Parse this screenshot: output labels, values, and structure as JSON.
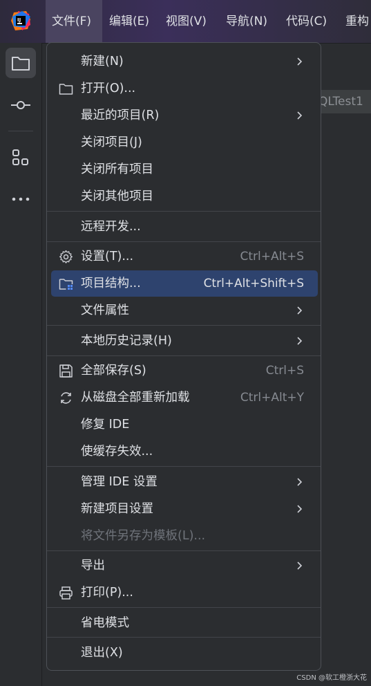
{
  "menubar": {
    "items": [
      "文件(F)",
      "编辑(E)",
      "视图(V)",
      "导航(N)",
      "代码(C)",
      "重构"
    ]
  },
  "editor": {
    "tab_fragment": "QLTest1"
  },
  "menu": {
    "items": [
      {
        "label": "新建(N)",
        "submenu": true
      },
      {
        "label": "打开(O)...",
        "icon": "folder-icon"
      },
      {
        "label": "最近的项目(R)",
        "submenu": true
      },
      {
        "label": "关闭项目(J)"
      },
      {
        "label": "关闭所有项目"
      },
      {
        "label": "关闭其他项目"
      },
      {
        "label": "远程开发..."
      },
      {
        "label": "设置(T)...",
        "icon": "gear-icon",
        "shortcut": "Ctrl+Alt+S"
      },
      {
        "label": "项目结构...",
        "icon": "project-structure-icon",
        "shortcut": "Ctrl+Alt+Shift+S",
        "selected": true
      },
      {
        "label": "文件属性",
        "submenu": true
      },
      {
        "label": "本地历史记录(H)",
        "submenu": true
      },
      {
        "label": "全部保存(S)",
        "icon": "save-icon",
        "shortcut": "Ctrl+S"
      },
      {
        "label": "从磁盘全部重新加载",
        "icon": "reload-icon",
        "shortcut": "Ctrl+Alt+Y"
      },
      {
        "label": "修复 IDE"
      },
      {
        "label": "使缓存失效..."
      },
      {
        "label": "管理 IDE 设置",
        "submenu": true
      },
      {
        "label": "新建项目设置",
        "submenu": true
      },
      {
        "label": "将文件另存为模板(L)...",
        "disabled": true
      },
      {
        "label": "导出",
        "submenu": true
      },
      {
        "label": "打印(P)...",
        "icon": "printer-icon"
      },
      {
        "label": "省电模式"
      },
      {
        "label": "退出(X)"
      }
    ]
  },
  "watermark": "CSDN @软工橙浙大花",
  "colors": {
    "background": "#2b2d30",
    "selection": "#2e436e",
    "border": "#4e5157",
    "text": "#dfe1e5",
    "shortcut_text": "#868a91",
    "disabled_text": "#6f737a"
  }
}
